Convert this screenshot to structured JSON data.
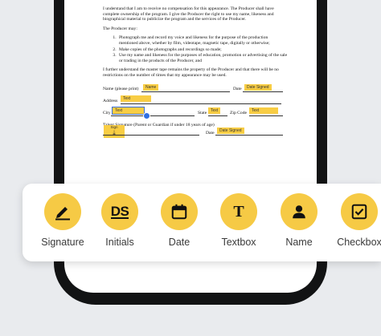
{
  "document": {
    "para1": "I understand that I am to receive no compensation for this appearance. The Producer shall have complete ownership of the program. I give the Producer the right to use my name, likeness and biographical material to publicize the program and the services of the Producer.",
    "para2": "The Producer may:",
    "items": [
      "Photograph me and record my voice and likeness for the purpose of the production mentioned above, whether by film, videotape, magnetic tape, digitally or otherwise;",
      "Make copies of the photographs and recordings so made;",
      "Use my name and likeness for the purposes of education, promotion or advertising of the sale or trading in the products of the Producer, and"
    ],
    "para3": "I further understand the master tape remains the property of the Producer and that there will be no restrictions on the number of times that my appearance may be used.",
    "labels": {
      "name": "Name (please print)",
      "date": "Date",
      "address": "Address",
      "city": "City",
      "state": "State",
      "zip": "Zip Code",
      "talent_sig": "Talent Signature (Parent or Guardian if under 18 years of age)",
      "date2": "Date"
    },
    "tags": {
      "name": "Name",
      "date_signed": "Date Signed",
      "address_text": "Text",
      "city_text": "Text",
      "state_text": "Text",
      "zip_text": "Text",
      "sign": "Sign",
      "date_signed2": "Date Signed"
    }
  },
  "toolbar": {
    "tools": [
      {
        "label": "Signature",
        "icon": "pen-icon"
      },
      {
        "label": "Initials",
        "icon": "initials-icon"
      },
      {
        "label": "Date",
        "icon": "calendar-icon"
      },
      {
        "label": "Textbox",
        "icon": "text-icon"
      },
      {
        "label": "Name",
        "icon": "person-icon"
      },
      {
        "label": "Checkbox",
        "icon": "checkbox-icon"
      }
    ],
    "initials_glyph": "DS",
    "text_glyph": "T",
    "accent": "#f6ca45"
  }
}
